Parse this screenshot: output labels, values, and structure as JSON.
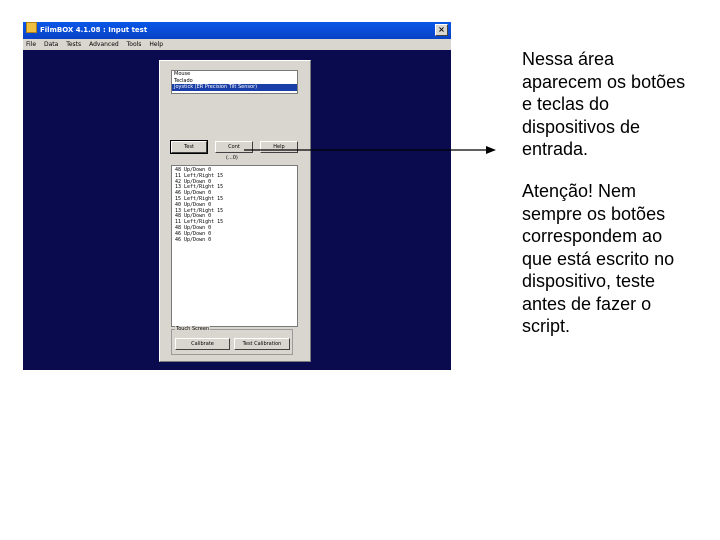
{
  "window": {
    "title": "FilmBOX 4.1.08 : Input test",
    "close_glyph": "×",
    "menu": [
      "File",
      "Data",
      "Tests",
      "Advanced",
      "Tools",
      "Help"
    ]
  },
  "dialog": {
    "device_list": [
      "Mouse",
      "Teclado",
      "Joystick (ER Precision Tilt Sensor)"
    ],
    "selected_index": 2,
    "buttons": {
      "test": "Test",
      "cont": "Cont",
      "help": "Help"
    },
    "counter": "(...0)",
    "output_lines": [
      "48 Up/Down 0",
      "11 Left/Right 15",
      "42 Up/Down 0",
      "13 Left/Right 15",
      "46 Up/Down 0",
      "15 Left/Right 15",
      "40 Up/Down 0",
      "13 Left/Right 15",
      "48 Up/Down 0",
      "11 Left/Right 15",
      "48 Up/Down 0",
      "46 Up/Down 0",
      "46 Up/Down 0"
    ],
    "touch_group": {
      "legend": "Touch Screen",
      "calibrate": "Calibrate",
      "test_calibration": "Test Calibration"
    }
  },
  "annotation": {
    "note1": "Nessa área aparecem os botões e teclas do dispositivos de entrada.",
    "note2": "Atenção! Nem sempre os botões correspondem ao que está escrito no dispositivo, teste antes de fazer o script."
  }
}
